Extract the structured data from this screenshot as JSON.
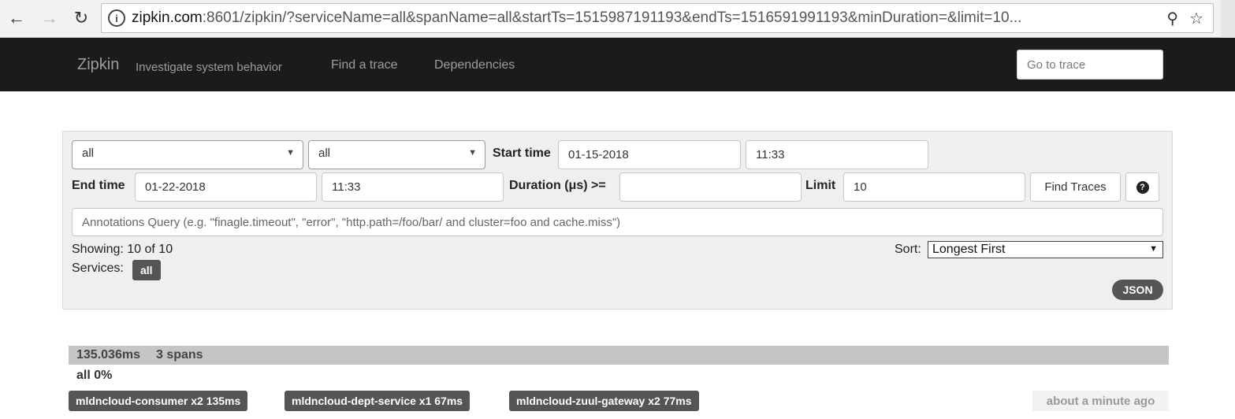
{
  "browser": {
    "url_host": "zipkin.com",
    "url_rest": ":8601/zipkin/?serviceName=all&spanName=all&startTs=1515987191193&endTs=1516591991193&minDuration=&limit=10...",
    "back_icon": "arrow-left-icon",
    "forward_icon": "arrow-right-icon",
    "reload_icon": "reload-icon",
    "info_icon": "info-icon",
    "zoom_icon": "zoom-icon",
    "bookmark_icon": "star-icon"
  },
  "navbar": {
    "brand": "Zipkin",
    "tagline": "Investigate system behavior",
    "links": [
      "Find a trace",
      "Dependencies"
    ],
    "goto_placeholder": "Go to trace"
  },
  "search": {
    "service_value": "all",
    "span_value": "all",
    "start_time_label": "Start time",
    "start_date": "01-15-2018",
    "start_clock": "11:33",
    "end_time_label": "End time",
    "end_date": "01-22-2018",
    "end_clock": "11:33",
    "duration_label": "Duration (μs) >=",
    "duration_value": "",
    "limit_label": "Limit",
    "limit_value": "10",
    "find_button": "Find Traces",
    "help_icon": "question-icon",
    "annotations_placeholder": "Annotations Query (e.g. \"finagle.timeout\", \"error\", \"http.path=/foo/bar/ and cluster=foo and cache.miss\")",
    "showing": "Showing: 10 of 10",
    "services_label": "Services:",
    "services_badge": "all",
    "sort_label": "Sort:",
    "sort_value": "Longest First",
    "json_button": "JSON"
  },
  "result": {
    "duration": "135.036ms",
    "spans": "3 spans",
    "percent_line": "all 0%",
    "services": [
      "mldncloud-consumer x2 135ms",
      "mldncloud-dept-service x1 67ms",
      "mldncloud-zuul-gateway x2 77ms"
    ],
    "timestamp": "about a minute ago"
  }
}
